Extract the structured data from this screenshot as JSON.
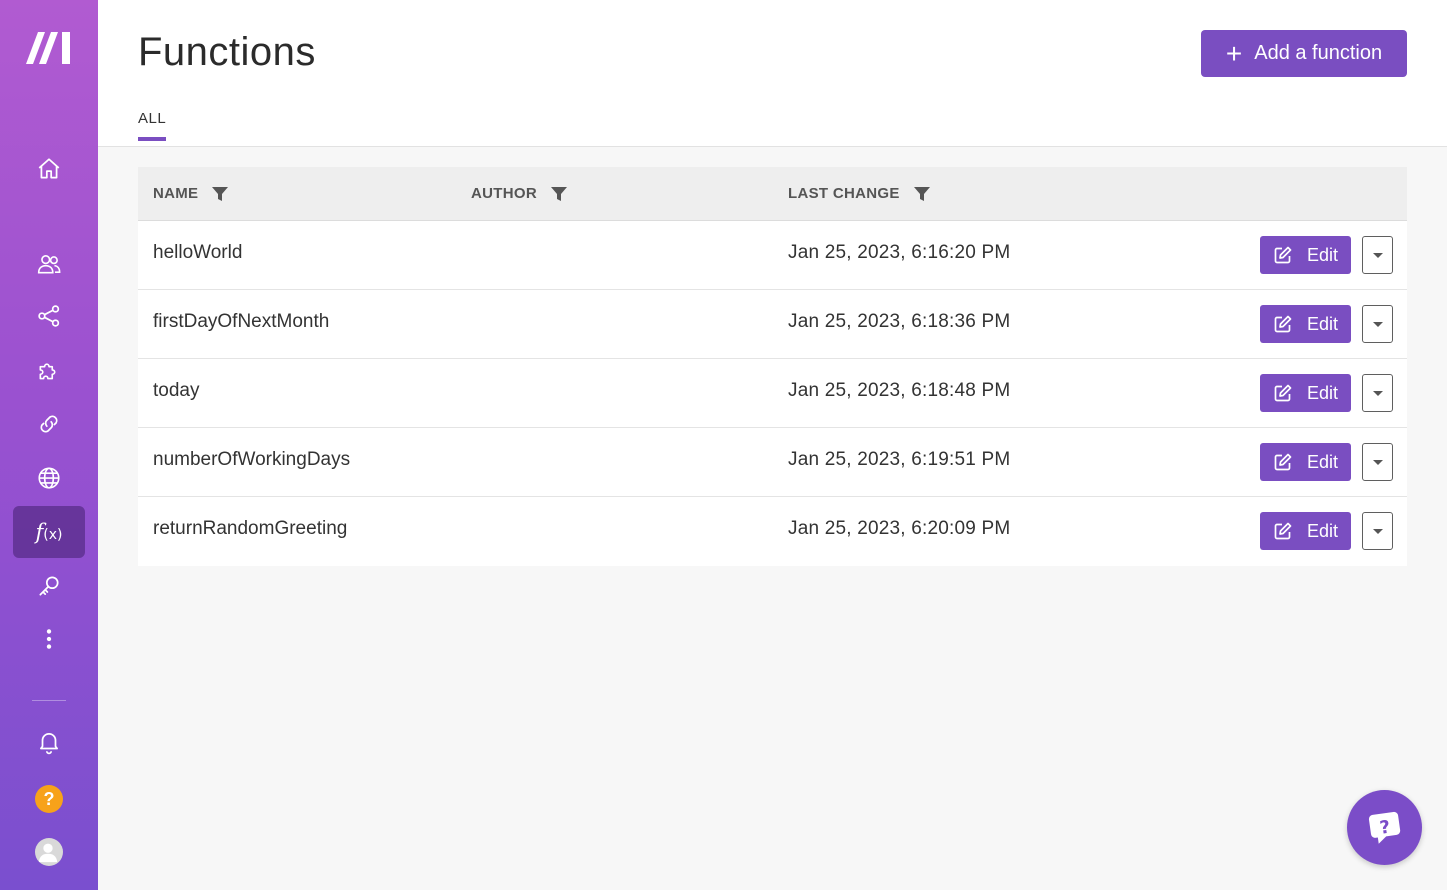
{
  "header": {
    "title": "Functions",
    "add_button_label": "Add a function",
    "tabs": [
      {
        "label": "ALL"
      }
    ]
  },
  "table": {
    "columns": [
      {
        "label": "NAME"
      },
      {
        "label": "AUTHOR"
      },
      {
        "label": "LAST CHANGE"
      }
    ],
    "rows": [
      {
        "name": "helloWorld",
        "author": "",
        "last_change": "Jan 25, 2023, 6:16:20 PM",
        "edit_label": "Edit"
      },
      {
        "name": "firstDayOfNextMonth",
        "author": "",
        "last_change": "Jan 25, 2023, 6:18:36 PM",
        "edit_label": "Edit"
      },
      {
        "name": "today",
        "author": "",
        "last_change": "Jan 25, 2023, 6:18:48 PM",
        "edit_label": "Edit"
      },
      {
        "name": "numberOfWorkingDays",
        "author": "",
        "last_change": "Jan 25, 2023, 6:19:51 PM",
        "edit_label": "Edit"
      },
      {
        "name": "returnRandomGreeting",
        "author": "",
        "last_change": "Jan 25, 2023, 6:20:09 PM",
        "edit_label": "Edit"
      }
    ]
  },
  "sidebar": {
    "items": [
      {
        "icon": "home-icon"
      },
      {
        "icon": "team-icon"
      },
      {
        "icon": "share-icon"
      },
      {
        "icon": "puzzle-icon"
      },
      {
        "icon": "link-icon"
      },
      {
        "icon": "globe-icon"
      },
      {
        "icon": "function-icon",
        "label": "f",
        "sub": "(x)",
        "active": true
      },
      {
        "icon": "key-icon"
      },
      {
        "icon": "more-icon"
      }
    ],
    "help_badge": "?",
    "bottom": [
      {
        "icon": "bell-icon"
      },
      {
        "icon": "help-icon"
      },
      {
        "icon": "avatar"
      }
    ]
  },
  "colors": {
    "accent": "#7a4ec1",
    "sidebar_top": "#b15bd1",
    "sidebar_bottom": "#7a4fcf",
    "help_badge": "#f7a21a"
  }
}
